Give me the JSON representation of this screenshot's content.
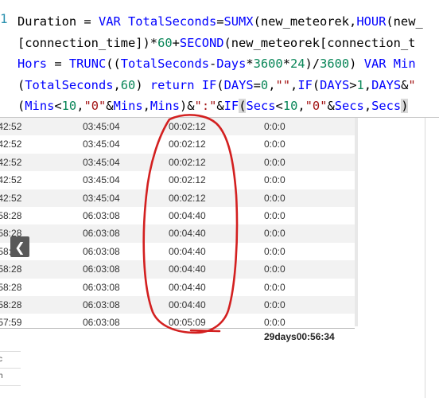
{
  "formula": {
    "line_number": "1",
    "lines": [
      [
        [
          "ref",
          "Duration = "
        ],
        [
          "kw",
          "VAR "
        ],
        [
          "fn",
          "TotalSeconds"
        ],
        [
          "ref",
          "="
        ],
        [
          "fn",
          "SUMX"
        ],
        [
          "ref",
          "(new_meteorek,"
        ],
        [
          "fn",
          "HOUR"
        ],
        [
          "ref",
          "(new_"
        ]
      ],
      [
        [
          "ref",
          "[connection_time])*"
        ],
        [
          "num",
          "60"
        ],
        [
          "ref",
          "+"
        ],
        [
          "fn",
          "SECOND"
        ],
        [
          "ref",
          "(new_meteorek[connection_t"
        ]
      ],
      [
        [
          "fn",
          "Hors "
        ],
        [
          "ref",
          "= "
        ],
        [
          "fn",
          "TRUNC"
        ],
        [
          "ref",
          "(("
        ],
        [
          "fn",
          "TotalSeconds"
        ],
        [
          "ref",
          "-"
        ],
        [
          "fn",
          "Days"
        ],
        [
          "ref",
          "*"
        ],
        [
          "num",
          "3600"
        ],
        [
          "ref",
          "*"
        ],
        [
          "num",
          "24"
        ],
        [
          "ref",
          ")/"
        ],
        [
          "num",
          "3600"
        ],
        [
          "ref",
          ") "
        ],
        [
          "kw",
          "VAR "
        ],
        [
          "fn",
          "Min"
        ]
      ],
      [
        [
          "ref",
          "("
        ],
        [
          "fn",
          "TotalSeconds"
        ],
        [
          "ref",
          ","
        ],
        [
          "num",
          "60"
        ],
        [
          "ref",
          ") "
        ],
        [
          "kw",
          "return "
        ],
        [
          "fn",
          "IF"
        ],
        [
          "ref",
          "("
        ],
        [
          "fn",
          "DAYS"
        ],
        [
          "ref",
          "="
        ],
        [
          "num",
          "0"
        ],
        [
          "ref",
          ","
        ],
        [
          "str",
          "\"\""
        ],
        [
          "ref",
          ","
        ],
        [
          "fn",
          "IF"
        ],
        [
          "ref",
          "("
        ],
        [
          "fn",
          "DAYS"
        ],
        [
          "ref",
          ">"
        ],
        [
          "num",
          "1"
        ],
        [
          "ref",
          ","
        ],
        [
          "fn",
          "DAYS"
        ],
        [
          "ref",
          "&"
        ],
        [
          "str",
          "\""
        ]
      ],
      [
        [
          "ref",
          "("
        ],
        [
          "fn",
          "Mins"
        ],
        [
          "ref",
          "<"
        ],
        [
          "num",
          "10"
        ],
        [
          "ref",
          ","
        ],
        [
          "str",
          "\"0\""
        ],
        [
          "ref",
          "&"
        ],
        [
          "fn",
          "Mins"
        ],
        [
          "ref",
          ","
        ],
        [
          "fn",
          "Mins"
        ],
        [
          "ref",
          ")&"
        ],
        [
          "str",
          "\":\""
        ],
        [
          "ref",
          "&"
        ],
        [
          "fn",
          "IF"
        ],
        [
          "hl",
          "("
        ],
        [
          "fn",
          "Secs"
        ],
        [
          "ref",
          "<"
        ],
        [
          "num",
          "10"
        ],
        [
          "ref",
          ","
        ],
        [
          "str",
          "\"0\""
        ],
        [
          "ref",
          "&"
        ],
        [
          "fn",
          "Secs"
        ],
        [
          "ref",
          ","
        ],
        [
          "fn",
          "Secs"
        ],
        [
          "hl",
          ")"
        ]
      ]
    ]
  },
  "table": {
    "rows": [
      [
        ":42:52",
        "03:45:04",
        "00:02:12",
        "0:0:0"
      ],
      [
        ":42:52",
        "03:45:04",
        "00:02:12",
        "0:0:0"
      ],
      [
        ":42:52",
        "03:45:04",
        "00:02:12",
        "0:0:0"
      ],
      [
        ":42:52",
        "03:45:04",
        "00:02:12",
        "0:0:0"
      ],
      [
        ":42:52",
        "03:45:04",
        "00:02:12",
        "0:0:0"
      ],
      [
        ":58:28",
        "06:03:08",
        "00:04:40",
        "0:0:0"
      ],
      [
        ":58:28",
        "06:03:08",
        "00:04:40",
        "0:0:0"
      ],
      [
        ":58:28",
        "06:03:08",
        "00:04:40",
        "0:0:0"
      ],
      [
        ":58:28",
        "06:03:08",
        "00:04:40",
        "0:0:0"
      ],
      [
        ":58:28",
        "06:03:08",
        "00:04:40",
        "0:0:0"
      ],
      [
        ":58:28",
        "06:03:08",
        "00:04:40",
        "0:0:0"
      ],
      [
        ":57:59",
        "06:03:08",
        "00:05:09",
        "0:0:0"
      ]
    ],
    "total": "29days00:56:34"
  },
  "nav": {
    "left_arrow_icon": "chevron-left-icon",
    "glyph": "❮"
  },
  "left_fragments": [
    "c",
    "h"
  ],
  "colors": {
    "annotation": "#d32020",
    "keyword": "#0000ff",
    "number": "#098658",
    "string": "#a31515"
  }
}
